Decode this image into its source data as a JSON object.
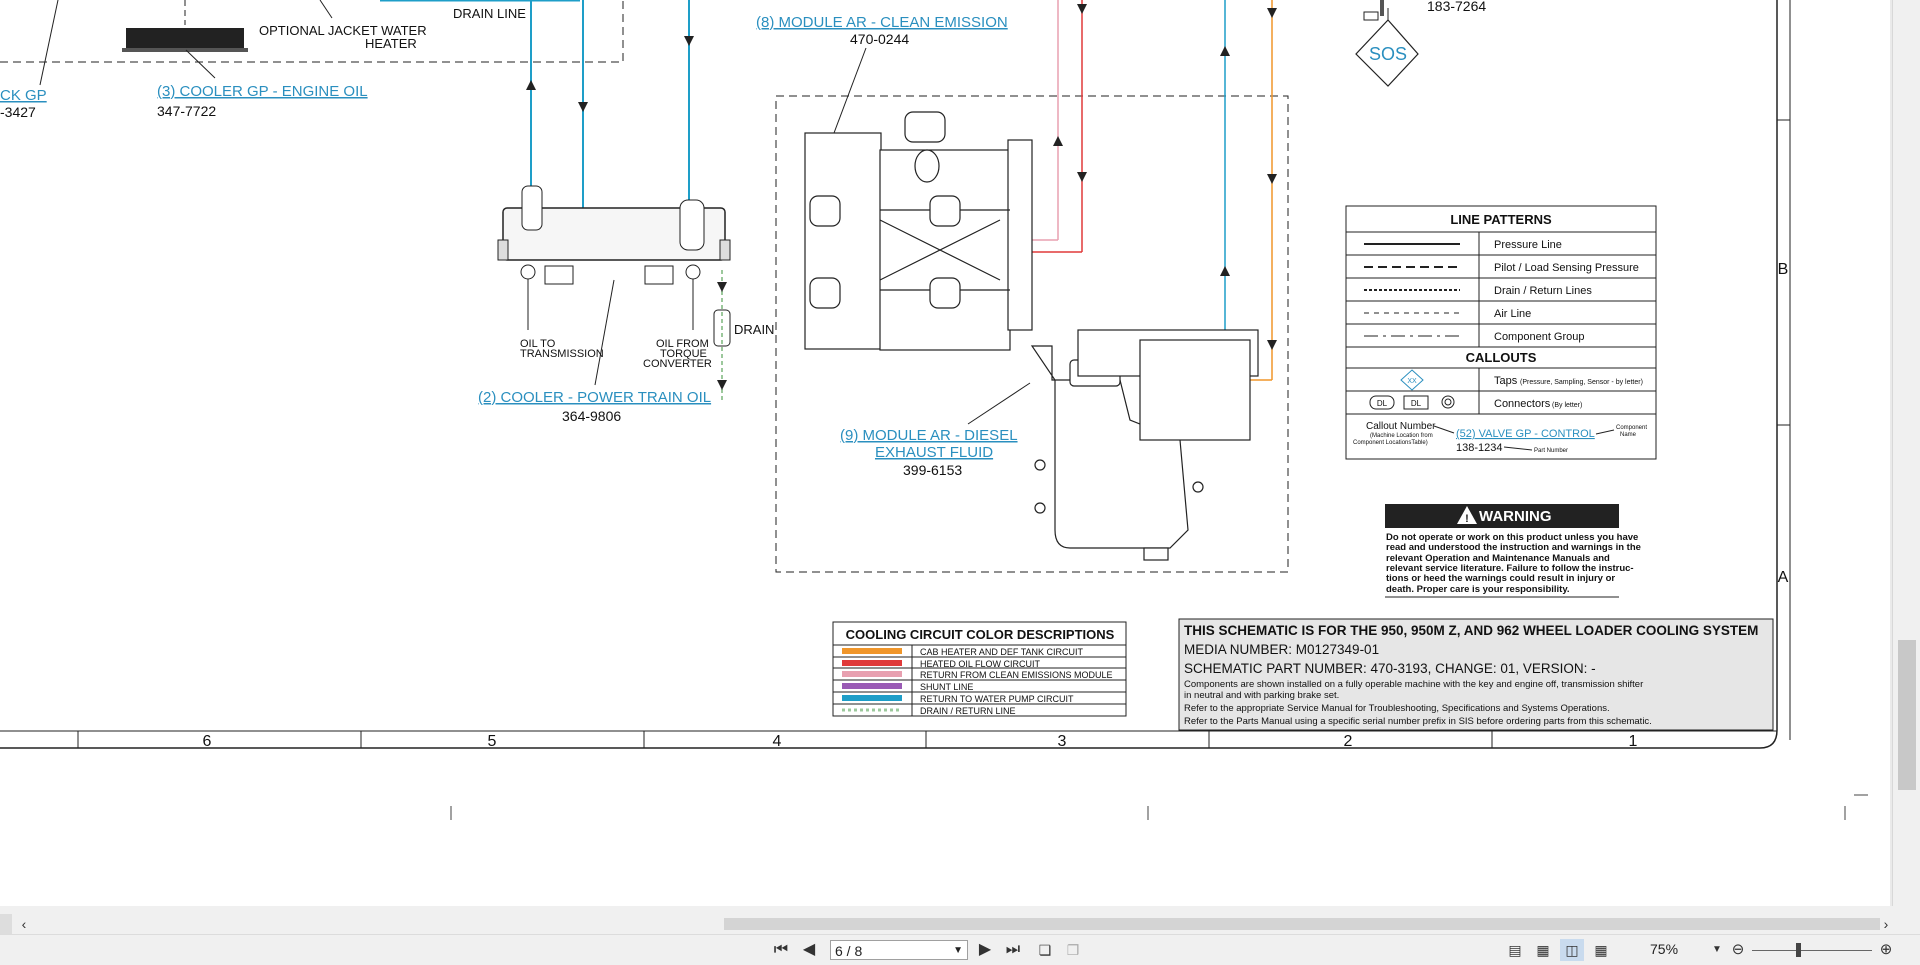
{
  "schematic": {
    "optional_heater": "OPTIONAL JACKET WATER HEATER",
    "drain_line": "DRAIN LINE",
    "callout_ckgp": "CK GP",
    "callout_ckgp_pn": "-3427",
    "engine_oil_cooler": {
      "name": "(3) COOLER GP - ENGINE OIL",
      "pn": "347-7722"
    },
    "power_train_cooler": {
      "name": "(2) COOLER - POWER TRAIN OIL",
      "pn": "364-9806"
    },
    "clean_emission": {
      "name": "(8) MODULE AR - CLEAN EMISSION",
      "pn": "470-0244"
    },
    "def_module": {
      "name_line1": "(9) MODULE AR - DIESEL",
      "name_line2": "EXHAUST FLUID",
      "pn": "399-6153"
    },
    "oil_to_trans": {
      "l1": "OIL TO",
      "l2": "TRANSMISSION"
    },
    "oil_from_tc": {
      "l1": "OIL FROM",
      "l2": "TORQUE",
      "l3": "CONVERTER"
    },
    "drain": "DRAIN",
    "sos_pn": "183-7264",
    "sos": "SOS"
  },
  "line_patterns": {
    "title": "LINE PATTERNS",
    "rows": [
      "Pressure Line",
      "Pilot / Load Sensing Pressure",
      "Drain / Return Lines",
      "Air Line",
      "Component Group"
    ],
    "callouts_title": "CALLOUTS",
    "taps_label": "Taps",
    "taps_note": "(Pressure, Sampling, Sensor - by letter)",
    "tap_symbol": "XX",
    "connectors_label": "Connectors",
    "connectors_note": "(By letter)",
    "conn_dl": "DL",
    "callout_number": "Callout Number",
    "callout_note_1": "(Machine Location from",
    "callout_note_2": "Component LocationsTable)",
    "callout_example": "(52) VALVE GP - CONTROL",
    "component_name_1": "Component",
    "component_name_2": "Name",
    "part_number_example": "138-1234",
    "part_number_label": "Part Number"
  },
  "warning": {
    "title": "WARNING",
    "lines": [
      "Do not operate or work on this product unless you have",
      "read and understood the instruction and warnings in the",
      "relevant Operation and Maintenance Manuals and",
      "relevant service literature. Failure to follow the instruc-",
      "tions or heed the warnings could result in injury or",
      "death. Proper care is your responsibility."
    ]
  },
  "color_desc": {
    "title": "COOLING CIRCUIT COLOR DESCRIPTIONS",
    "rows": [
      {
        "color": "#f0962a",
        "label": "CAB HEATER AND DEF TANK CIRCUIT"
      },
      {
        "color": "#e03a3a",
        "label": "HEATED OIL FLOW CIRCUIT"
      },
      {
        "color": "#e8a0b0",
        "label": "RETURN FROM CLEAN EMISSIONS MODULE"
      },
      {
        "color": "#9a5bb5",
        "label": "SHUNT LINE"
      },
      {
        "color": "#1e9ec8",
        "label": "RETURN TO WATER PUMP CIRCUIT"
      },
      {
        "color": "#9cc89c",
        "label": "DRAIN / RETURN LINE"
      }
    ]
  },
  "title_block": {
    "title": "THIS SCHEMATIC IS FOR THE 950, 950M Z, AND 962 WHEEL LOADER COOLING SYSTEM",
    "media": "MEDIA NUMBER: M0127349-01",
    "part": "SCHEMATIC PART NUMBER: 470-3193, CHANGE: 01, VERSION: -",
    "note1": "Components are shown installed on a fully operable machine with the key and engine off, transmission shifter",
    "note2": "in neutral and with parking brake set.",
    "note3": "Refer to the appropriate Service Manual for Troubleshooting, Specifications and Systems Operations.",
    "note4": "Refer to the Parts Manual using a specific serial number prefix in SIS before ordering parts from this schematic."
  },
  "grid": {
    "cols": [
      "6",
      "5",
      "4",
      "3",
      "2",
      "1"
    ],
    "rows": [
      "B",
      "A"
    ]
  },
  "toolbar": {
    "page": "6 / 8",
    "zoom": "75%"
  },
  "icons": [
    "first-page-icon",
    "prev-page-icon",
    "next-page-icon",
    "last-page-icon",
    "single-page-icon",
    "continuous-icon",
    "facing-icon",
    "continuous-facing-icon",
    "zoom-out-icon",
    "zoom-in-icon"
  ]
}
